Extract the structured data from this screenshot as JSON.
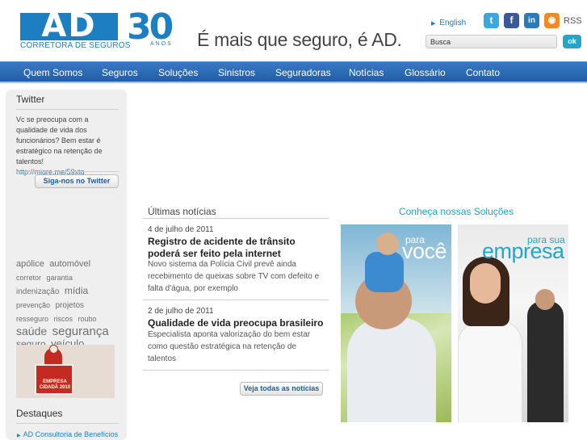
{
  "header": {
    "logo_text": "AD",
    "logo_subtitle": "CORRETORA DE SEGUROS",
    "anniversary_number": "30",
    "anniversary_label": "ANOS",
    "slogan": "É mais que seguro, é AD.",
    "language_link": "English",
    "rss_label": "RSS",
    "search_value": "Busca",
    "search_button": "ok"
  },
  "social_icons": [
    "twitter-icon",
    "facebook-icon",
    "linkedin-icon",
    "rss-icon"
  ],
  "nav": {
    "items": [
      "Quem Somos",
      "Seguros",
      "Soluções",
      "Sinistros",
      "Seguradoras",
      "Notícias",
      "Glossário",
      "Contato"
    ]
  },
  "sidebar": {
    "twitter_title": "Twitter",
    "tweet_text": "Vc se preocupa com a qualidade de vida dos funcionários? Bem estar é estratégico na retenção de talentos!",
    "tweet_link": "http://migre.me/59xtg",
    "follow_button": "Siga-nos no Twitter",
    "tags": [
      {
        "text": "apólice",
        "size": 11
      },
      {
        "text": "automóvel",
        "size": 11
      },
      {
        "text": "corretor",
        "size": 9
      },
      {
        "text": "garantia",
        "size": 9
      },
      {
        "text": "indenização",
        "size": 10
      },
      {
        "text": "mídia",
        "size": 12
      },
      {
        "text": "prevenção",
        "size": 9
      },
      {
        "text": "projetos",
        "size": 10
      },
      {
        "text": "resseguro",
        "size": 9
      },
      {
        "text": "riscos",
        "size": 9
      },
      {
        "text": "roubo",
        "size": 9
      },
      {
        "text": "saúde",
        "size": 14
      },
      {
        "text": "segurança",
        "size": 15
      },
      {
        "text": "seguro",
        "size": 12
      },
      {
        "text": "veículo",
        "size": 13
      }
    ],
    "award_text": "EMPRESA CIDADÃ 2010",
    "highlights_title": "Destaques",
    "highlights_items": [
      "AD Consultoria de Benefícios"
    ]
  },
  "news": {
    "title": "Últimas notícias",
    "items": [
      {
        "date": "4 de julho de 2011",
        "headline": "Registro de acidente de trânsito poderá ser feito pela internet",
        "summary": "Novo sistema da Polícia Civil prevê ainda recebimento de queixas sobre TV com defeito e falta d'água, por exemplo"
      },
      {
        "date": "2 de julho de 2011",
        "headline": "Qualidade de vida preocupa brasileiro",
        "summary": "Especialista aponta valorização do bem estar como questão estratégica na retenção de talentos"
      }
    ],
    "all_button": "Veja todas as notícias"
  },
  "solutions": {
    "title": "Conheça nossas Soluções",
    "voce_small": "para",
    "voce_big": "você",
    "empresa_small": "para sua",
    "empresa_big": "empresa"
  },
  "colors": {
    "brand_blue": "#1d7fc1",
    "nav_blue": "#2b6bb6",
    "teal": "#25a6c6"
  }
}
